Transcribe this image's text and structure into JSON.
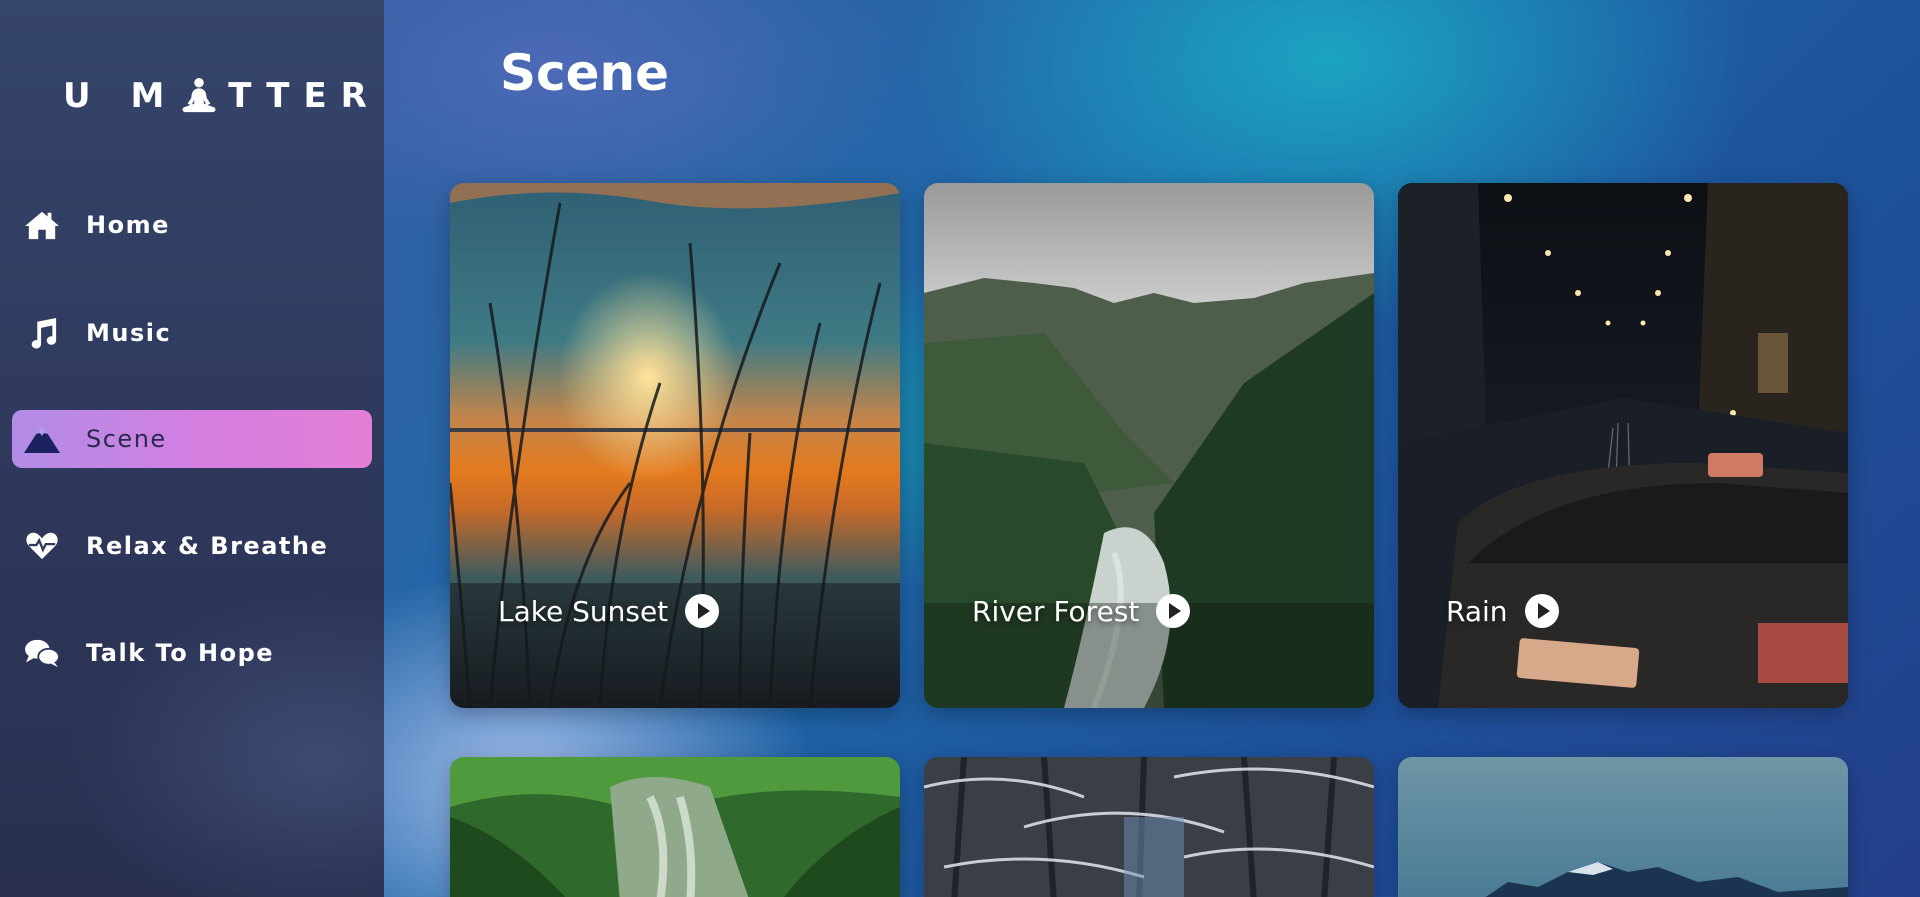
{
  "app": {
    "logo_left": "U M",
    "logo_right": "TTER",
    "logo_icon": "meditation-icon"
  },
  "sidebar": {
    "items": [
      {
        "label": "Home",
        "icon": "home-icon",
        "active": false
      },
      {
        "label": "Music",
        "icon": "music-note-icon",
        "active": false
      },
      {
        "label": "Scene",
        "icon": "mountain-icon",
        "active": true
      },
      {
        "label": "Relax & Breathe",
        "icon": "heartbeat-icon",
        "active": false
      },
      {
        "label": "Talk To Hope",
        "icon": "chat-bubbles-icon",
        "active": false
      }
    ]
  },
  "main": {
    "title": "Scene",
    "scenes": [
      {
        "name": "Lake Sunset",
        "icon": "play-icon"
      },
      {
        "name": "River Forest",
        "icon": "play-icon"
      },
      {
        "name": "Rain",
        "icon": "play-icon"
      },
      {
        "name": "",
        "icon": ""
      },
      {
        "name": "",
        "icon": ""
      },
      {
        "name": "",
        "icon": ""
      }
    ]
  },
  "colors": {
    "active_nav_start": "#b28ce8",
    "active_nav_end": "#e47fd6",
    "sidebar_bg": "#2f3a5e",
    "text": "#ffffff"
  }
}
